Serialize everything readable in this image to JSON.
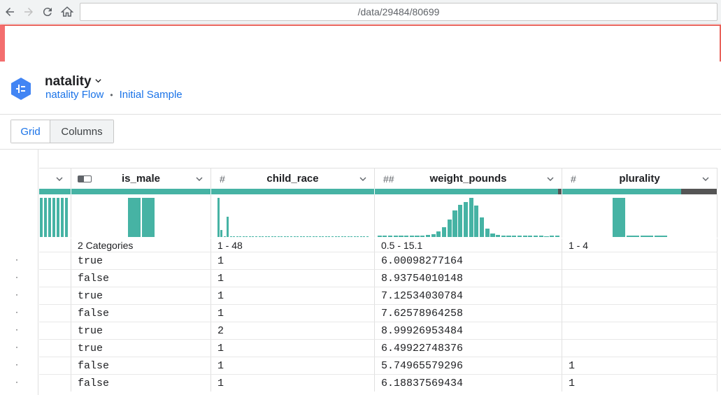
{
  "browser": {
    "url": "/data/29484/80699"
  },
  "header": {
    "title": "natality",
    "breadcrumbs": [
      "natality Flow",
      "Initial Sample"
    ],
    "separator": "•"
  },
  "tabs": {
    "grid": "Grid",
    "columns": "Columns"
  },
  "columns": [
    {
      "type_icon": "",
      "name": "",
      "range": ""
    },
    {
      "type_icon": "toggle-icon",
      "name": "is_male",
      "range": "2 Categories"
    },
    {
      "type_icon": "#",
      "name": "child_race",
      "range": "1 - 48"
    },
    {
      "type_icon": "##",
      "name": "weight_pounds",
      "range": "0.5 - 15.1"
    },
    {
      "type_icon": "#",
      "name": "plurality",
      "range": "1 - 4"
    }
  ],
  "histograms": {
    "col0": [
      3,
      3,
      3,
      3,
      3,
      3,
      3
    ],
    "is_male": [
      52,
      52
    ],
    "child_race": [
      55,
      10,
      1,
      28,
      0,
      0,
      0,
      0,
      1,
      0,
      0,
      0,
      0,
      0,
      0,
      0,
      1,
      0,
      0,
      0,
      0,
      0,
      1,
      0,
      0,
      0,
      0,
      0,
      0,
      0,
      0,
      0,
      0,
      1,
      0,
      0,
      0,
      1,
      0,
      0,
      0,
      0,
      0,
      1,
      0,
      1,
      0,
      1
    ],
    "weight_pounds": [
      2,
      2,
      2,
      2,
      2,
      2,
      2,
      2,
      2,
      3,
      4,
      8,
      14,
      25,
      38,
      46,
      50,
      56,
      45,
      28,
      12,
      5,
      3,
      2,
      2,
      2,
      2,
      2,
      2,
      2,
      2,
      1,
      2,
      2
    ],
    "plurality": [
      56,
      2,
      2,
      2
    ]
  },
  "rows": [
    {
      "is_male": "true",
      "child_race": "1",
      "weight_pounds": "6.00098277164",
      "plurality": ""
    },
    {
      "is_male": "false",
      "child_race": "1",
      "weight_pounds": "8.93754010148",
      "plurality": ""
    },
    {
      "is_male": "true",
      "child_race": "1",
      "weight_pounds": "7.12534030784",
      "plurality": ""
    },
    {
      "is_male": "false",
      "child_race": "1",
      "weight_pounds": "7.62578964258",
      "plurality": ""
    },
    {
      "is_male": "true",
      "child_race": "2",
      "weight_pounds": "8.99926953484",
      "plurality": ""
    },
    {
      "is_male": "true",
      "child_race": "1",
      "weight_pounds": "6.49922748376",
      "plurality": ""
    },
    {
      "is_male": "false",
      "child_race": "1",
      "weight_pounds": "5.74965579296",
      "plurality": "1"
    },
    {
      "is_male": "false",
      "child_race": "1",
      "weight_pounds": "6.18837569434",
      "plurality": "1"
    }
  ],
  "row_marker": "·",
  "colors": {
    "accent": "#1a73e8",
    "histogram": "#46b3a4",
    "invalid": "#555555",
    "alert": "#e8615a"
  }
}
